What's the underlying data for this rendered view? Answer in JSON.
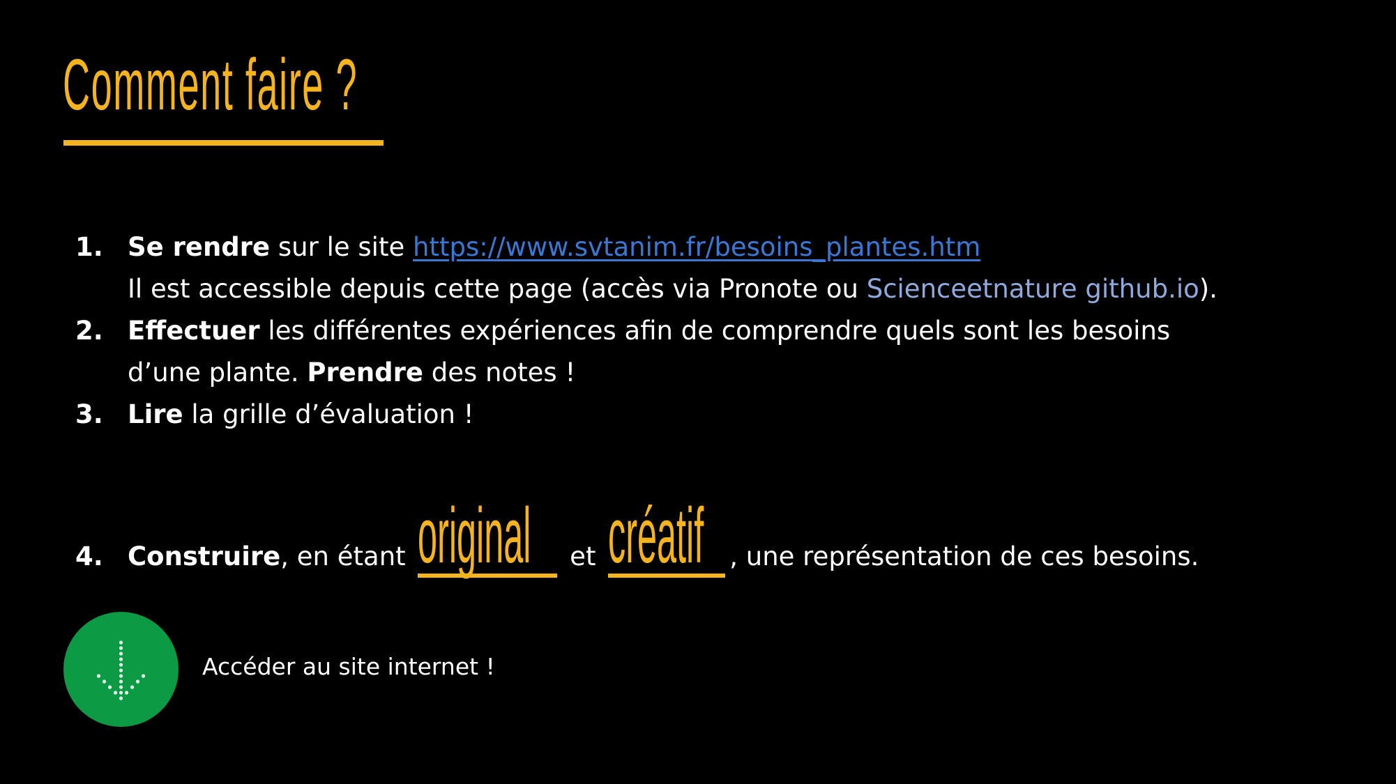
{
  "title": "Comment faire ?",
  "steps": [
    {
      "number": "1.",
      "verb": "Se rendre",
      "text": " sur le site ",
      "link": "https://www.svtanim.fr/besoins_plantes.htm",
      "line2_text": "Il est accessible depuis cette page (accès via Pronote ou ",
      "line2_link": "Scienceetnature github.io",
      "line2_end": ")."
    },
    {
      "number": "2.",
      "verb": "Effectuer",
      "text": " les différentes expériences afin de comprendre quels sont les besoins",
      "line2_text": "d’une plante. ",
      "line2_verb": "Prendre",
      "line2_end": " des notes !"
    },
    {
      "number": "3.",
      "verb": "Lire",
      "text": " la grille d’évaluation !"
    },
    {
      "number": "4.",
      "verb": "Construire",
      "text_before": ", en étant ",
      "word1": "original",
      "connector": " et ",
      "word2": "créatif",
      "text_after": ", une représentation de ces besoins."
    }
  ],
  "access_button": {
    "icon": "arrow-down-icon",
    "label": "Accéder au site internet !",
    "color": "#0d9a45"
  },
  "colors": {
    "background": "#000000",
    "accent": "#f5b41d",
    "link": "#3a78d6",
    "link_alt": "#8faadf",
    "text": "#ffffff"
  }
}
